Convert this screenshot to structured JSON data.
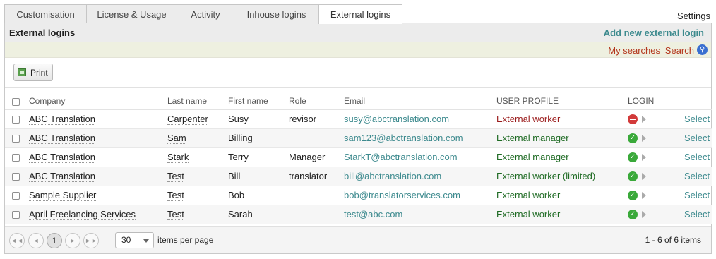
{
  "tabs": [
    {
      "label": "Customisation"
    },
    {
      "label": "License & Usage"
    },
    {
      "label": "Activity"
    },
    {
      "label": "Inhouse logins"
    },
    {
      "label": "External logins"
    }
  ],
  "settings_label": "Settings",
  "panel": {
    "title": "External logins",
    "add_link": "Add new external login",
    "my_searches": "My searches",
    "search": "Search",
    "print_label": "Print"
  },
  "table": {
    "headers": {
      "company": "Company",
      "last_name": "Last name",
      "first_name": "First name",
      "role": "Role",
      "email": "Email",
      "user_profile": "USER PROFILE",
      "login": "LOGIN"
    },
    "select_label": "Select",
    "rows": [
      {
        "company": "ABC Translation",
        "last_name": "Carpenter",
        "first_name": "Susy",
        "role": "revisor",
        "email": "susy@abctranslation.com",
        "profile": "External worker",
        "login": "blocked"
      },
      {
        "company": "ABC Translation",
        "last_name": "Sam",
        "first_name": "Billing",
        "role": "",
        "email": "sam123@abctranslation.com",
        "profile": "External manager",
        "login": "ok"
      },
      {
        "company": "ABC Translation",
        "last_name": "Stark",
        "first_name": "Terry",
        "role": "Manager",
        "email": "StarkT@abctranslation.com",
        "profile": "External manager",
        "login": "ok"
      },
      {
        "company": "ABC Translation",
        "last_name": "Test",
        "first_name": "Bill",
        "role": "translator",
        "email": "bill@abctranslation.com",
        "profile": "External worker (limited)",
        "login": "ok"
      },
      {
        "company": "Sample Supplier",
        "last_name": "Test",
        "first_name": "Bob",
        "role": "",
        "email": "bob@translatorservices.com",
        "profile": "External worker",
        "login": "ok"
      },
      {
        "company": "April Freelancing Services",
        "last_name": "Test",
        "first_name": "Sarah",
        "role": "",
        "email": "test@abc.com",
        "profile": "External worker",
        "login": "ok"
      }
    ]
  },
  "pager": {
    "current_page": "1",
    "page_size": "30",
    "per_page_label": "items per page",
    "items_info": "1 - 6 of 6 items"
  }
}
